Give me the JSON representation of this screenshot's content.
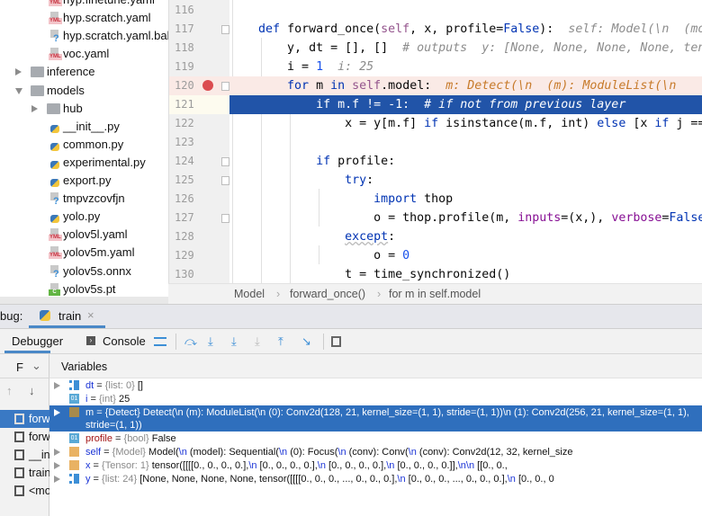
{
  "project_tree": [
    {
      "label": "hyp.finetune.yaml",
      "type": "yaml",
      "level": 2
    },
    {
      "label": "hyp.scratch.yaml",
      "type": "yaml",
      "level": 2
    },
    {
      "label": "hyp.scratch.yaml.bak",
      "type": "unknown",
      "level": 2
    },
    {
      "label": "voc.yaml",
      "type": "yaml",
      "level": 2
    },
    {
      "label": "inference",
      "type": "folder",
      "level": 1,
      "expanded": false
    },
    {
      "label": "models",
      "type": "folder",
      "level": 1,
      "expanded": true
    },
    {
      "label": "hub",
      "type": "folder",
      "level": 2,
      "expanded": false
    },
    {
      "label": "__init__.py",
      "type": "python",
      "level": 2
    },
    {
      "label": "common.py",
      "type": "python",
      "level": 2
    },
    {
      "label": "experimental.py",
      "type": "python",
      "level": 2
    },
    {
      "label": "export.py",
      "type": "python",
      "level": 2
    },
    {
      "label": "tmpvzcovfjn",
      "type": "unknown",
      "level": 2
    },
    {
      "label": "yolo.py",
      "type": "python",
      "level": 2
    },
    {
      "label": "yolov5l.yaml",
      "type": "yaml",
      "level": 2
    },
    {
      "label": "yolov5m.yaml",
      "type": "yaml",
      "level": 2
    },
    {
      "label": "yolov5s.onnx",
      "type": "unknown",
      "level": 2
    },
    {
      "label": "yolov5s.pt",
      "type": "binary",
      "level": 2
    }
  ],
  "editor": {
    "line_numbers": [
      "116",
      "117",
      "118",
      "119",
      "120",
      "121",
      "122",
      "123",
      "124",
      "125",
      "126",
      "127",
      "128",
      "129",
      "130"
    ],
    "breakpoint_line": "120",
    "current_line": "121",
    "code": {
      "l117a": "def",
      "l117b": " forward_once(",
      "l117c": "self",
      ", ": ", ",
      "l117d": "x, profile=",
      "l117e": "False",
      "l117f": "):",
      "l117h": "self: Model(\\n  (model): Sequential(",
      "l118a": "y, dt = [], []  ",
      "l118b": "# outputs",
      "l118h": "y: [None, None, None, None, tensor(",
      "l119a": "i = ",
      "l119b": "1",
      "l119h": "i: 25",
      "l120a": "for",
      "l120b": " m ",
      "l120c": "in",
      "l120d": " ",
      "l120e": "self",
      ".model": ".model:",
      "l120h": "m: Detect(\\n  (m): ModuleList(\\n",
      "l121a": "if m.f != -1:  ",
      "l121b": "# if not from previous layer",
      "l122a": "x = y[m.f] ",
      "l122b": "if",
      " isinstance": " isinstance(m.f, int) ",
      "l122c": "else",
      " [x ": " [x ",
      "l122d": "if",
      " j ==": " j ==",
      "l124a": "if",
      " profile:": " profile:",
      "l125a": "try",
      ":": ":",
      "l126a": "import",
      " thop": " thop",
      "l127a": "o = thop.profile(m, ",
      "l127b": "inputs",
      "l127c": "=(x,), ",
      "l127d": "verbose",
      "l127e": "=",
      "l127f": "False",
      "l128a": "except",
      "l129a": "o = ",
      "l129b": "0",
      "l130a": "t = time_synchronized()"
    }
  },
  "breadcrumb": [
    "Model",
    "forward_once()",
    "for m in self.model"
  ],
  "debug": {
    "label": "bug:",
    "tab": "train",
    "toolbar": {
      "debugger": "Debugger",
      "console": "Console"
    },
    "frames_header": "F",
    "variables_header": "Variables",
    "frames": [
      "forw",
      "forw",
      "__ini",
      "train",
      "<mo"
    ],
    "variables": [
      {
        "name": "dt",
        "type": "{list: 0}",
        "value": "[]",
        "icon": "list",
        "expandable": true
      },
      {
        "name": "i",
        "type": "{int}",
        "value": "25",
        "icon": "int",
        "expandable": false
      },
      {
        "name": "m",
        "type": "{Detect}",
        "value": "Detect(\\n  (m): ModuleList(\\n    (0): Conv2d(128, 21, kernel_size=(1, 1), stride=(1, 1))\\n    (1): Conv2d(256, 21, kernel_size=(1, 1), stride=(1, 1))",
        "icon": "object",
        "expandable": true,
        "selected": true
      },
      {
        "name": "profile",
        "type": "{bool}",
        "value": "False",
        "icon": "bool",
        "expandable": false
      },
      {
        "name": "self",
        "type": "{Model}",
        "value": "Model(\\n  (model): Sequential(\\n    (0): Focus(\\n      (conv): Conv(\\n        (conv): Conv2d(12, 32, kernel_size",
        "icon": "object",
        "expandable": true
      },
      {
        "name": "x",
        "type": "{Tensor: 1}",
        "value": "tensor([[[[0., 0., 0., 0.],\\n          [0., 0., 0., 0.],\\n          [0., 0., 0., 0.],\\n          [0., 0., 0., 0.]],\\n\\n         [[0., 0.,",
        "icon": "object",
        "expandable": true
      },
      {
        "name": "y",
        "type": "{list: 24}",
        "value": "[None, None, None, None, tensor([[[[0., 0., 0.,  ..., 0., 0., 0.],\\n          [0., 0., 0.,  ..., 0., 0., 0.],\\n          [0., 0., 0",
        "icon": "list",
        "expandable": true
      }
    ]
  },
  "colors": {
    "current_line": "#2154a8",
    "breakpoint": "#db4c50",
    "selected_variable": "#2f6fbd"
  }
}
